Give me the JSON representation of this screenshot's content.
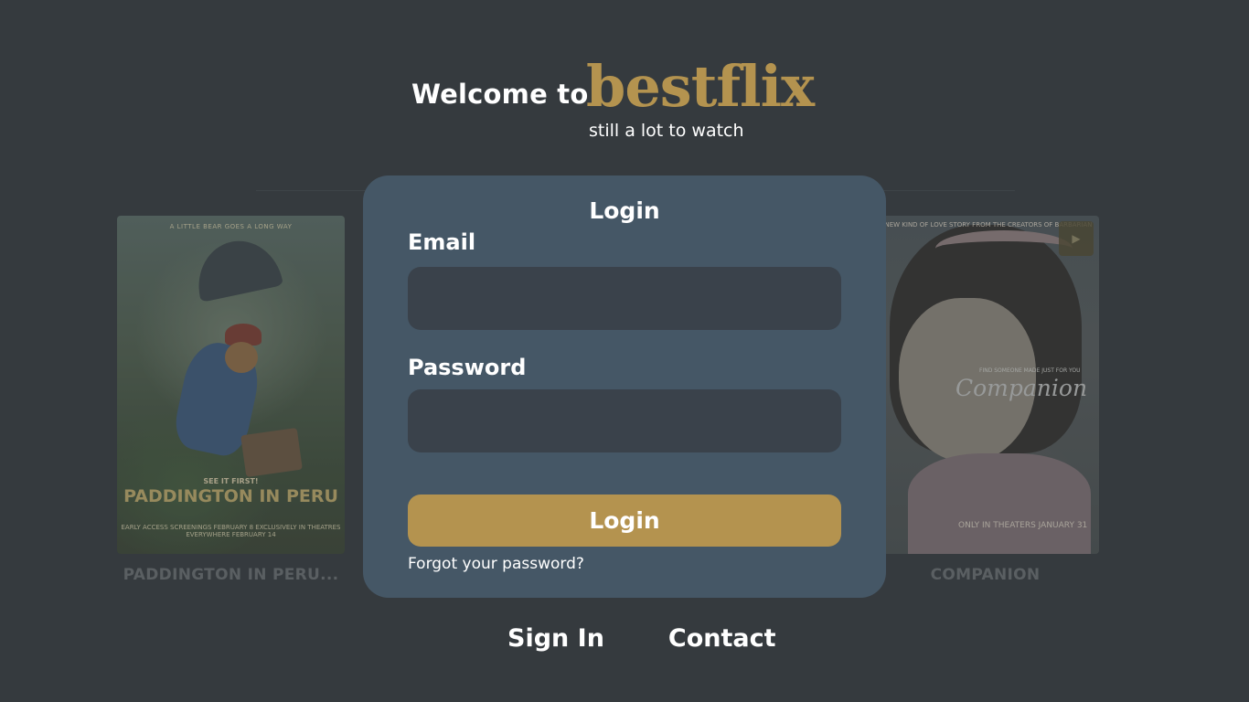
{
  "header": {
    "welcome": "Welcome to",
    "logo": "bestflix",
    "tagline": "still a lot to watch"
  },
  "movies": [
    {
      "title": "PADDINGTON IN PERU...",
      "poster": {
        "kicker": "A LITTLE BEAR GOES A LONG WAY",
        "see_it": "SEE IT FIRST!",
        "title": "PADDINGTON IN PERU",
        "sub": "EARLY ACCESS SCREENINGS FEBRUARY 8 EXCLUSIVELY IN THEATRES EVERYWHERE FEBRUARY 14"
      }
    },
    {
      "title": "COMPANION",
      "poster": {
        "top_text": "A NEW KIND OF LOVE STORY FROM THE CREATORS OF BARBARIAN",
        "kicker": "FIND SOMEONE MADE JUST FOR YOU",
        "script_title": "Companion",
        "date": "ONLY IN THEATERS JANUARY 31"
      }
    }
  ],
  "login": {
    "title": "Login",
    "email_label": "Email",
    "email_value": "",
    "password_label": "Password",
    "password_value": "",
    "submit_label": "Login",
    "forgot_label": "Forgot your password?"
  },
  "footer": {
    "links": [
      "Sign In",
      "Contact"
    ]
  },
  "colors": {
    "background": "#353a3e",
    "card": "#455766",
    "input": "#3a424b",
    "accent": "#b4934f"
  },
  "icons": {
    "play": "play-icon"
  }
}
